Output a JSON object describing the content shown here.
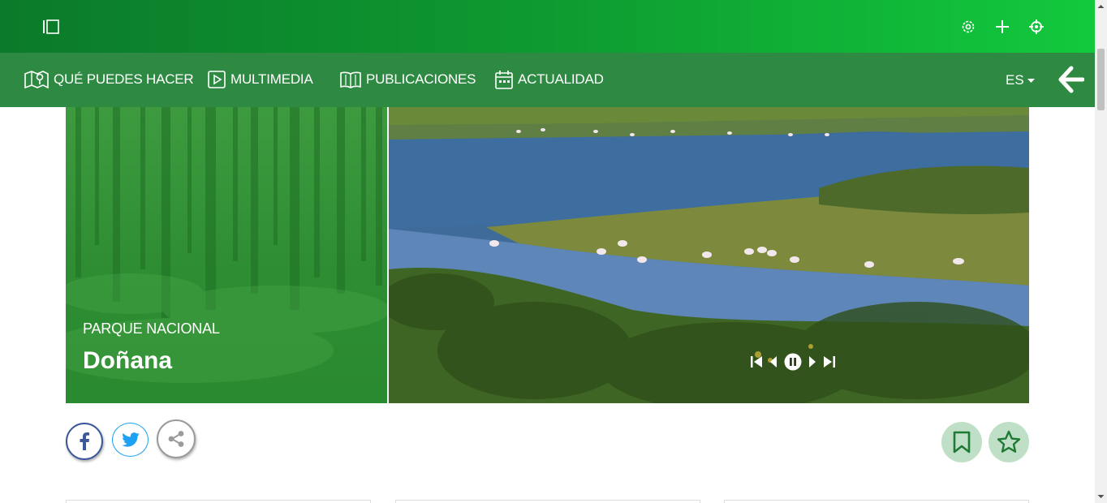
{
  "nav": {
    "items": [
      {
        "label": "QUÉ PUEDES HACER",
        "icon": "map-pin-icon"
      },
      {
        "label": "MULTIMEDIA",
        "icon": "play-icon"
      },
      {
        "label": "PUBLICACIONES",
        "icon": "book-icon"
      },
      {
        "label": "ACTUALIDAD",
        "icon": "calendar-icon"
      }
    ],
    "language": "ES"
  },
  "top_icons": [
    "settings-icon",
    "add-icon",
    "location-target-icon"
  ],
  "hero": {
    "subtitle": "PARQUE NACIONAL",
    "title": "Doñana",
    "controls": [
      "first-icon",
      "previous-icon",
      "pause-icon",
      "next-icon",
      "last-icon"
    ]
  },
  "share": [
    "facebook-icon",
    "twitter-icon",
    "share-icon"
  ],
  "actions": [
    "bookmark-icon",
    "star-icon"
  ],
  "colors": {
    "header_gradient_start": "#0b7a2a",
    "header_gradient_end": "#12c93d",
    "nav_bg": "#2e8a42",
    "facebook": "#3b5998",
    "twitter": "#1da1f2",
    "action_bg": "#bfe0c7",
    "action_icon": "#1e7a34"
  }
}
